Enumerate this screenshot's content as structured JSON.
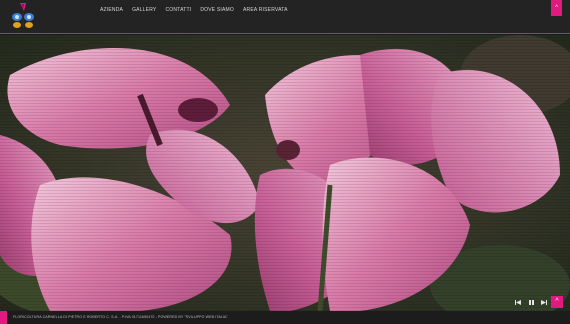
{
  "header": {
    "logo_icon": "butterfly-cyclamen-logo",
    "nav": [
      {
        "label": "AZIENDA"
      },
      {
        "label": "GALLERY"
      },
      {
        "label": "CONTATTI"
      },
      {
        "label": "DOVE SIAMO"
      },
      {
        "label": "AREA RISERVATA"
      }
    ],
    "menu_icon": "chevron-up-icon"
  },
  "slideshow": {
    "image_subject": "pink cyclamen flowers",
    "controls": [
      {
        "icon": "previous-icon"
      },
      {
        "icon": "pause-icon"
      },
      {
        "icon": "next-icon"
      }
    ],
    "scroll_top_icon": "chevron-up-icon"
  },
  "footer": {
    "text": "FLORICOLTURA CARNELLA DI PIETRO E ROBERTO C. S.A. - P.IVA 01711650470 - POWERED BY \"SVILUPPO WEB ITALIA\""
  },
  "colors": {
    "accent": "#e2197f",
    "header_bg": "#232323",
    "footer_bg": "#1c1c1c"
  }
}
